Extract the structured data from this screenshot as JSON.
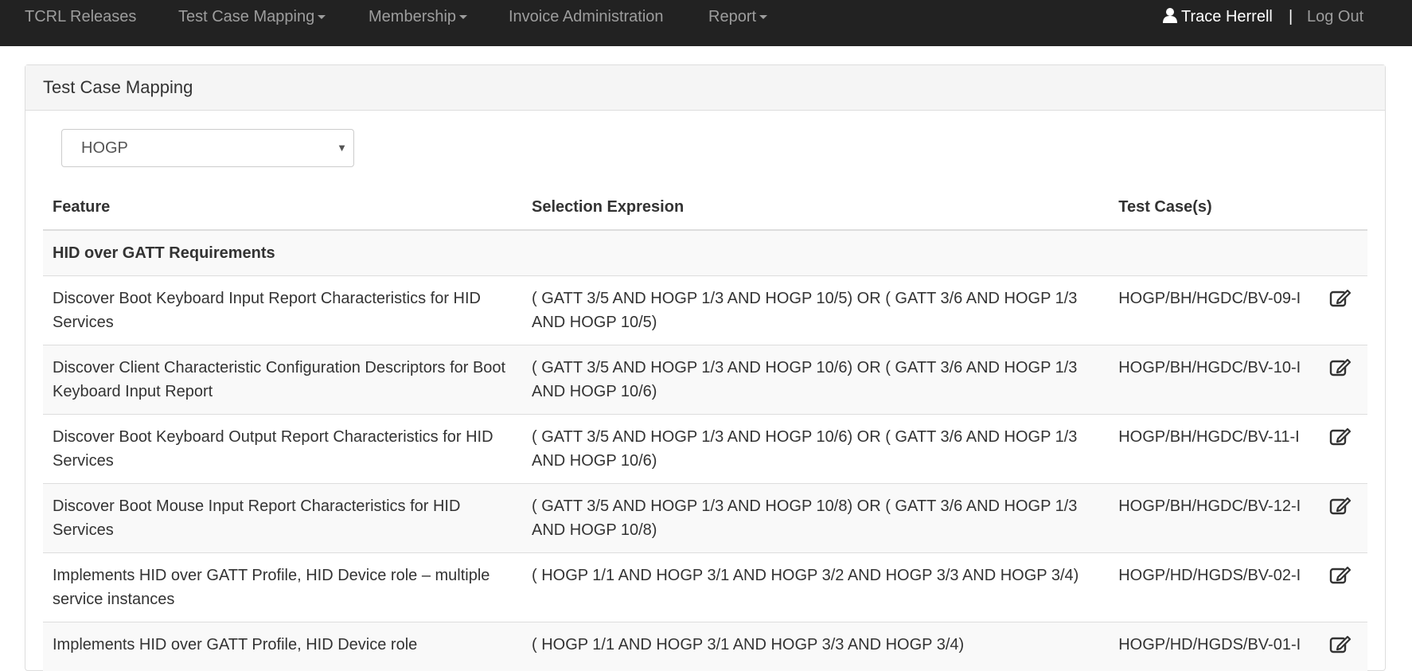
{
  "nav": {
    "items": [
      {
        "label": "TCRL Releases",
        "dropdown": false
      },
      {
        "label": "Test Case Mapping",
        "dropdown": true
      },
      {
        "label": "Membership",
        "dropdown": true
      },
      {
        "label": "Invoice Administration",
        "dropdown": false
      },
      {
        "label": "Report",
        "dropdown": true
      }
    ],
    "user_name": "Trace Herrell",
    "separator": "|",
    "logout_label": "Log Out",
    "user_icon": "user-icon"
  },
  "panel": {
    "title": "Test Case Mapping",
    "profile_select": {
      "value": "HOGP"
    }
  },
  "table": {
    "headers": [
      "Feature",
      "Selection Expresion",
      "Test Case(s)"
    ],
    "group_label": "HID over GATT Requirements",
    "rows": [
      {
        "feature": "Discover Boot Keyboard Input Report Characteristics for HID Services",
        "expression": "( GATT 3/5 AND HOGP 1/3 AND HOGP 10/5) OR ( GATT 3/6 AND HOGP 1/3 AND HOGP 10/5)",
        "test_case": "HOGP/BH/HGDC/BV-09-I"
      },
      {
        "feature": "Discover Client Characteristic Configuration Descriptors for Boot Keyboard Input Report",
        "expression": "( GATT 3/5 AND HOGP 1/3 AND HOGP 10/6) OR ( GATT 3/6 AND HOGP 1/3 AND HOGP 10/6)",
        "test_case": "HOGP/BH/HGDC/BV-10-I"
      },
      {
        "feature": "Discover Boot Keyboard Output Report Characteristics for HID Services",
        "expression": "( GATT 3/5 AND HOGP 1/3 AND HOGP 10/6) OR ( GATT 3/6 AND HOGP 1/3 AND HOGP 10/6)",
        "test_case": "HOGP/BH/HGDC/BV-11-I"
      },
      {
        "feature": "Discover Boot Mouse Input Report Characteristics for HID Services",
        "expression": "( GATT 3/5 AND HOGP 1/3 AND HOGP 10/8) OR ( GATT 3/6 AND HOGP 1/3 AND HOGP 10/8)",
        "test_case": "HOGP/BH/HGDC/BV-12-I"
      },
      {
        "feature": "Implements HID over GATT Profile, HID Device role – multiple service instances",
        "expression": "( HOGP 1/1 AND HOGP 3/1 AND HOGP 3/2 AND HOGP 3/3 AND HOGP 3/4)",
        "test_case": "HOGP/HD/HGDS/BV-02-I"
      },
      {
        "feature": "Implements HID over GATT Profile, HID Device role",
        "expression": "( HOGP 1/1 AND HOGP 3/1 AND HOGP 3/3 AND HOGP 3/4)",
        "test_case": "HOGP/HD/HGDS/BV-01-I"
      }
    ],
    "row_action_icon": "edit-icon"
  }
}
